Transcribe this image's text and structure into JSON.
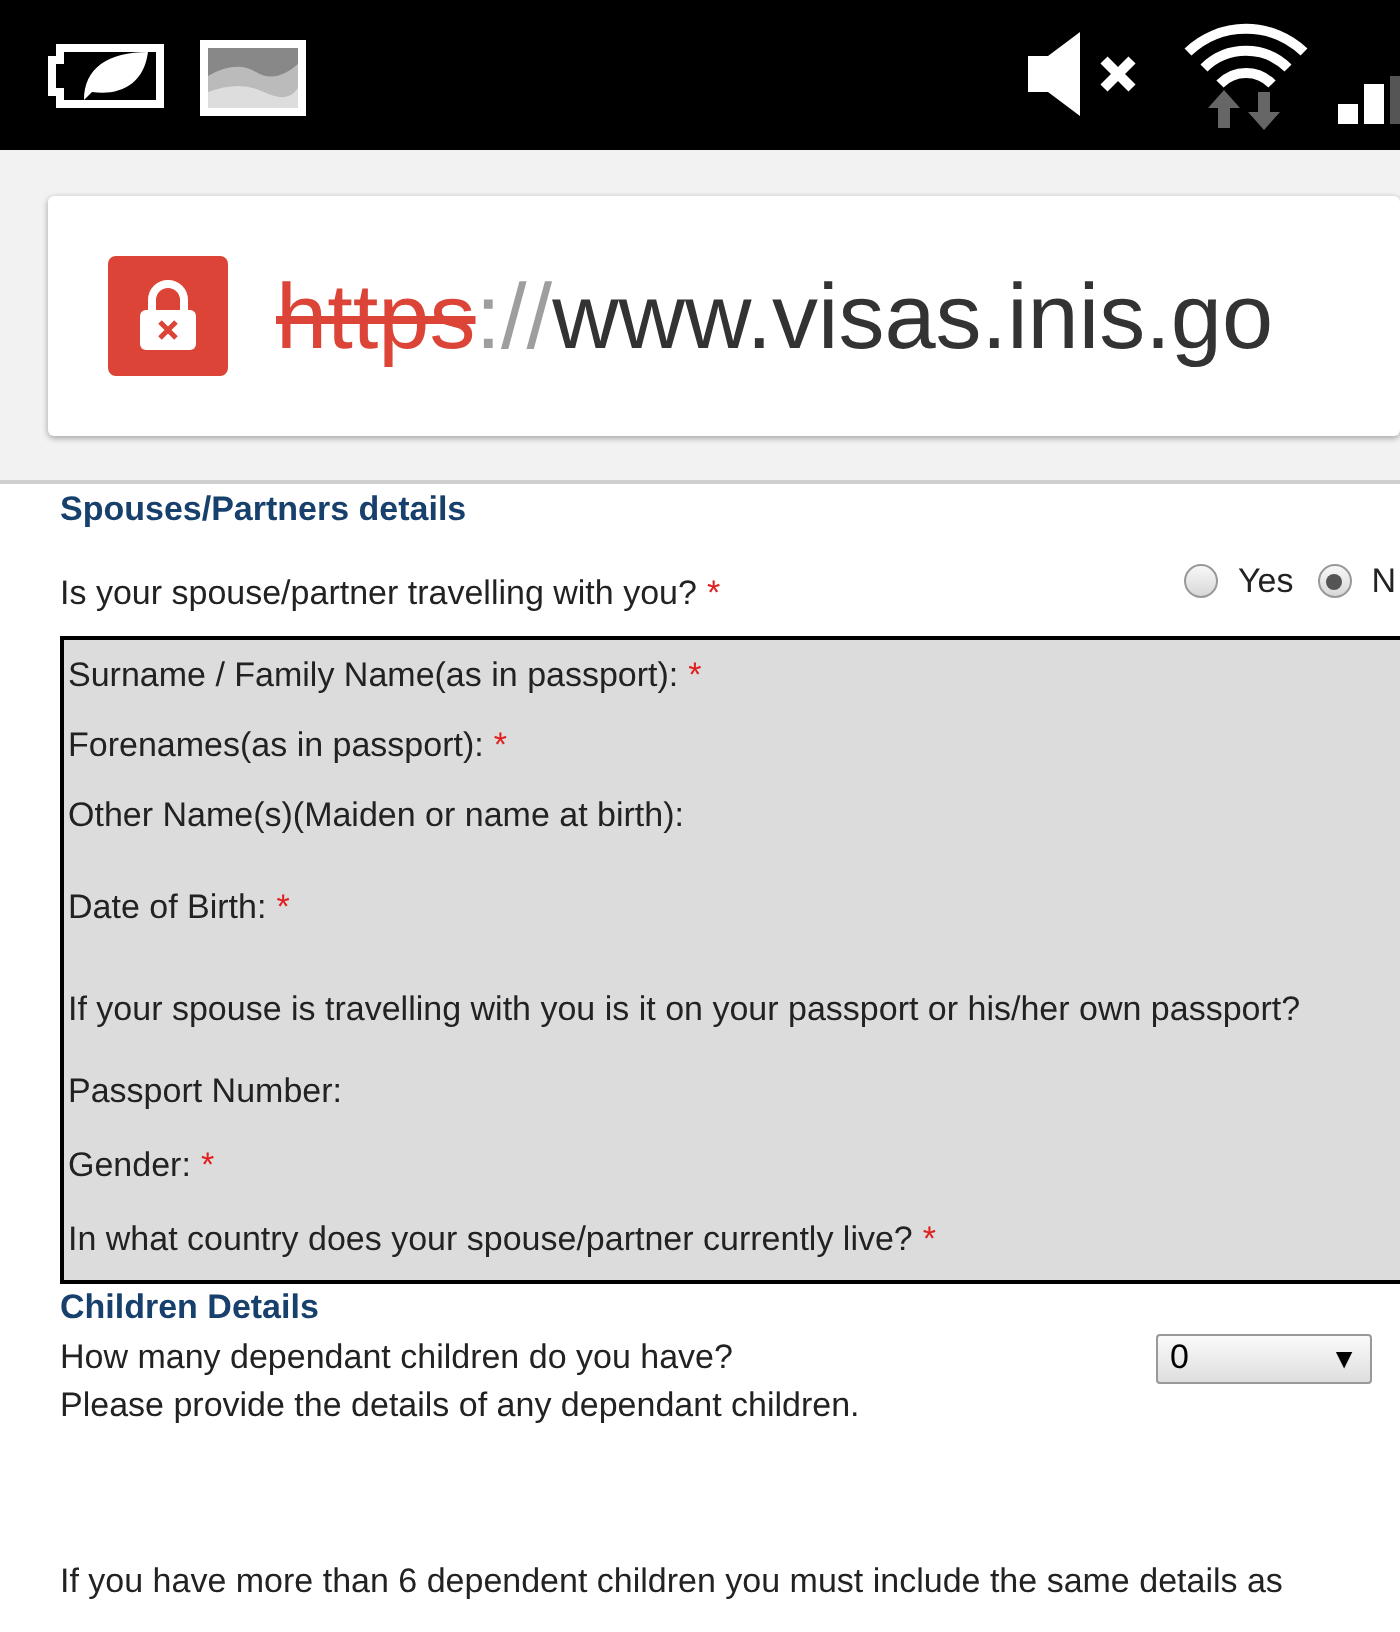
{
  "address_bar": {
    "scheme": "https",
    "separator": "://",
    "host": "www.visas.inis.go"
  },
  "spouse_section": {
    "heading": "Spouses/Partners details",
    "question": {
      "text": "Is your spouse/partner travelling with you?",
      "required_mark": "*"
    },
    "options": [
      {
        "label": "Yes",
        "selected": false
      },
      {
        "label": "N",
        "selected": true
      }
    ],
    "fields": [
      {
        "label": "Surname / Family Name(as in passport):",
        "required_mark": "*"
      },
      {
        "label": "Forenames(as in passport):",
        "required_mark": "*"
      },
      {
        "label": "Other Name(s)(Maiden or name at birth):"
      },
      {
        "label": "Date of Birth:",
        "required_mark": "*"
      },
      {
        "label": "If your spouse is travelling with you is it on your passport or his/her own passport?"
      },
      {
        "label": "Passport Number:"
      },
      {
        "label": "Gender:",
        "required_mark": "*"
      },
      {
        "label": "In what country does your spouse/partner currently live?",
        "required_mark": "*"
      }
    ]
  },
  "children_section": {
    "heading": "Children Details",
    "question": "How many dependant children do you have?",
    "select": {
      "value": "0",
      "arrow": "▼"
    },
    "instruction": "Please provide the details of any dependant children.",
    "note": "If you have more than 6 dependent children you must include the same details as"
  }
}
